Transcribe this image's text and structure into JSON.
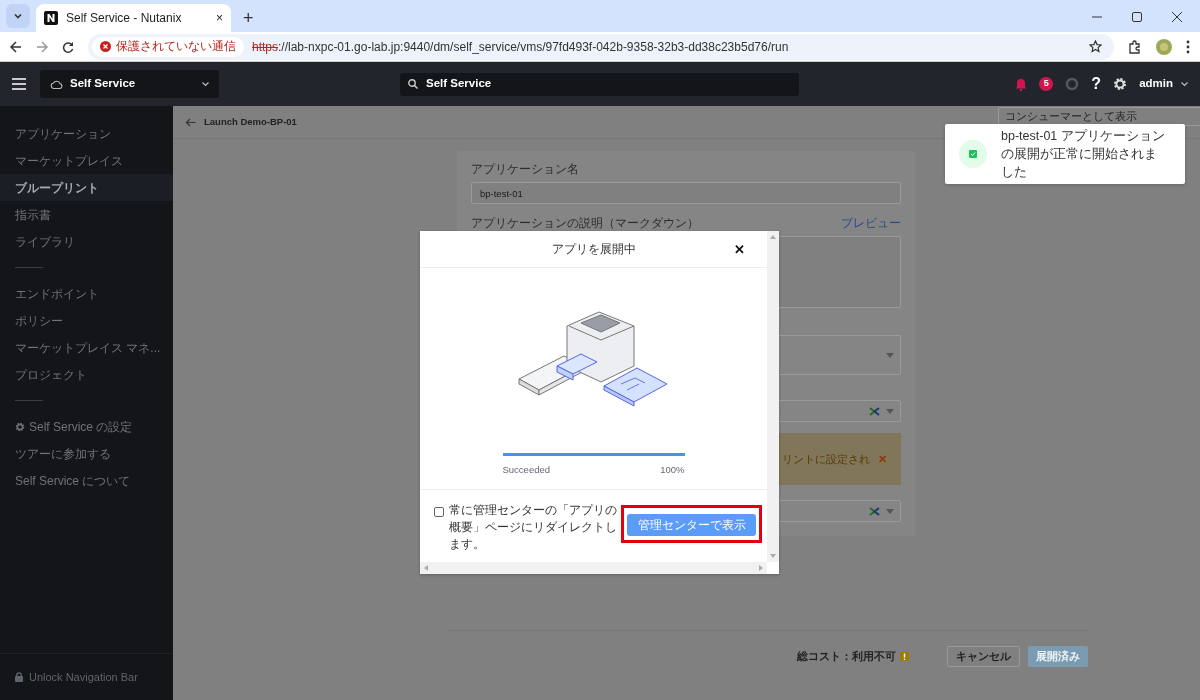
{
  "browser": {
    "tab": {
      "title": "Self Service - Nutanix",
      "close": "×"
    },
    "new_tab": "+",
    "security_chip": "保護されていない通信",
    "url": {
      "scheme": "https",
      "rest": "://lab-nxpc-01.go-lab.jp:9440/dm/self_service/vms/97fd493f-042b-9358-32b3-dd38c23b5d76/run"
    }
  },
  "header": {
    "product": "Self Service",
    "search_value": "Self Service",
    "alerts_count": "5",
    "help": "?",
    "user": "admin"
  },
  "sidebar": {
    "groups": [
      [
        {
          "label": "アプリケーション",
          "kind": "link",
          "selected": false
        },
        {
          "label": "マーケットプレイス",
          "kind": "link",
          "selected": false
        },
        {
          "label": "ブループリント",
          "kind": "link",
          "selected": true
        },
        {
          "label": "指示書",
          "kind": "link",
          "selected": false
        },
        {
          "label": "ライブラリ",
          "kind": "link",
          "selected": false
        }
      ],
      [
        {
          "label": "エンドポイント",
          "kind": "link",
          "selected": false
        },
        {
          "label": "ポリシー",
          "kind": "link",
          "selected": false
        },
        {
          "label": "マーケットプレイス マネ...",
          "kind": "link",
          "selected": false
        },
        {
          "label": "プロジェクト",
          "kind": "link",
          "selected": false
        }
      ],
      [
        {
          "label": "Self Service の設定",
          "kind": "settings",
          "selected": false
        },
        {
          "label": "ツアーに参加する",
          "kind": "link",
          "selected": false
        },
        {
          "label": "Self Service について",
          "kind": "link",
          "selected": false
        }
      ]
    ],
    "footer": "Unlock Navigation Bar"
  },
  "page": {
    "breadcrumb": "Launch Demo-BP-01",
    "consumer_button": "コンシューマーとして表示",
    "form": {
      "name_label": "アプリケーション名",
      "name_value": "bp-test-01",
      "desc_label": "アプリケーションの説明（マークダウン）",
      "preview_link": "プレビュー",
      "warning_text": "リントに設定され",
      "warning_close": "✕"
    },
    "footer": {
      "cost": "総コスト：利用不可",
      "cancel": "キャンセル",
      "deploy": "展開済み",
      "deploy_disabled": true
    }
  },
  "modal": {
    "title": "アプリを展開中",
    "close": "✕",
    "progress": {
      "level": 1,
      "status": "Succeeded",
      "percent": "100%"
    },
    "redirect_checkbox": {
      "label": "常に管理センターの「アプリの概要」ページにリダイレクトします。",
      "checked": false
    },
    "primary_button": "管理センターで表示",
    "highlighted": true
  },
  "toast": {
    "message": "bp-test-01 アプリケーションの展開が正常に開始されました"
  }
}
